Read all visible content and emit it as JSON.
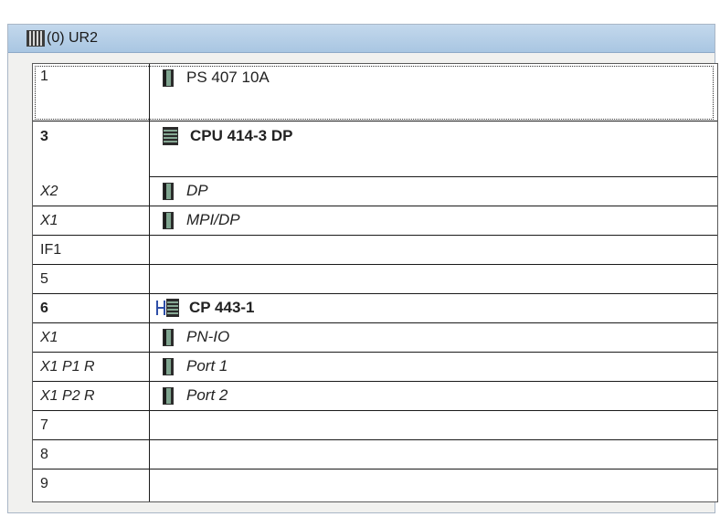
{
  "window": {
    "title": "(0) UR2"
  },
  "rows": [
    {
      "slot": "1",
      "module": "PS 407 10A",
      "icon": "module-icon"
    },
    {
      "slot": "3",
      "module": "CPU 414-3 DP",
      "icon": "cpu-icon"
    },
    {
      "slot": "X2",
      "module": "DP",
      "icon": "module-icon"
    },
    {
      "slot": "X1",
      "module": "MPI/DP",
      "icon": "module-icon"
    },
    {
      "slot": "IF1",
      "module": "",
      "icon": ""
    },
    {
      "slot": "5",
      "module": "",
      "icon": ""
    },
    {
      "slot": "6",
      "module": "CP 443-1",
      "icon": "network-cp-icon"
    },
    {
      "slot": "X1",
      "module": "PN-IO",
      "icon": "module-icon"
    },
    {
      "slot": "X1 P1 R",
      "module": "Port 1",
      "icon": "module-icon"
    },
    {
      "slot": "X1 P2 R",
      "module": "Port 2",
      "icon": "module-icon"
    },
    {
      "slot": "7",
      "module": "",
      "icon": ""
    },
    {
      "slot": "8",
      "module": "",
      "icon": ""
    },
    {
      "slot": "9",
      "module": "",
      "icon": ""
    }
  ],
  "colors": {
    "titlebar": "#b3cde6",
    "frame_bg": "#f1f1ef",
    "grid_line": "#1a1a1a"
  }
}
